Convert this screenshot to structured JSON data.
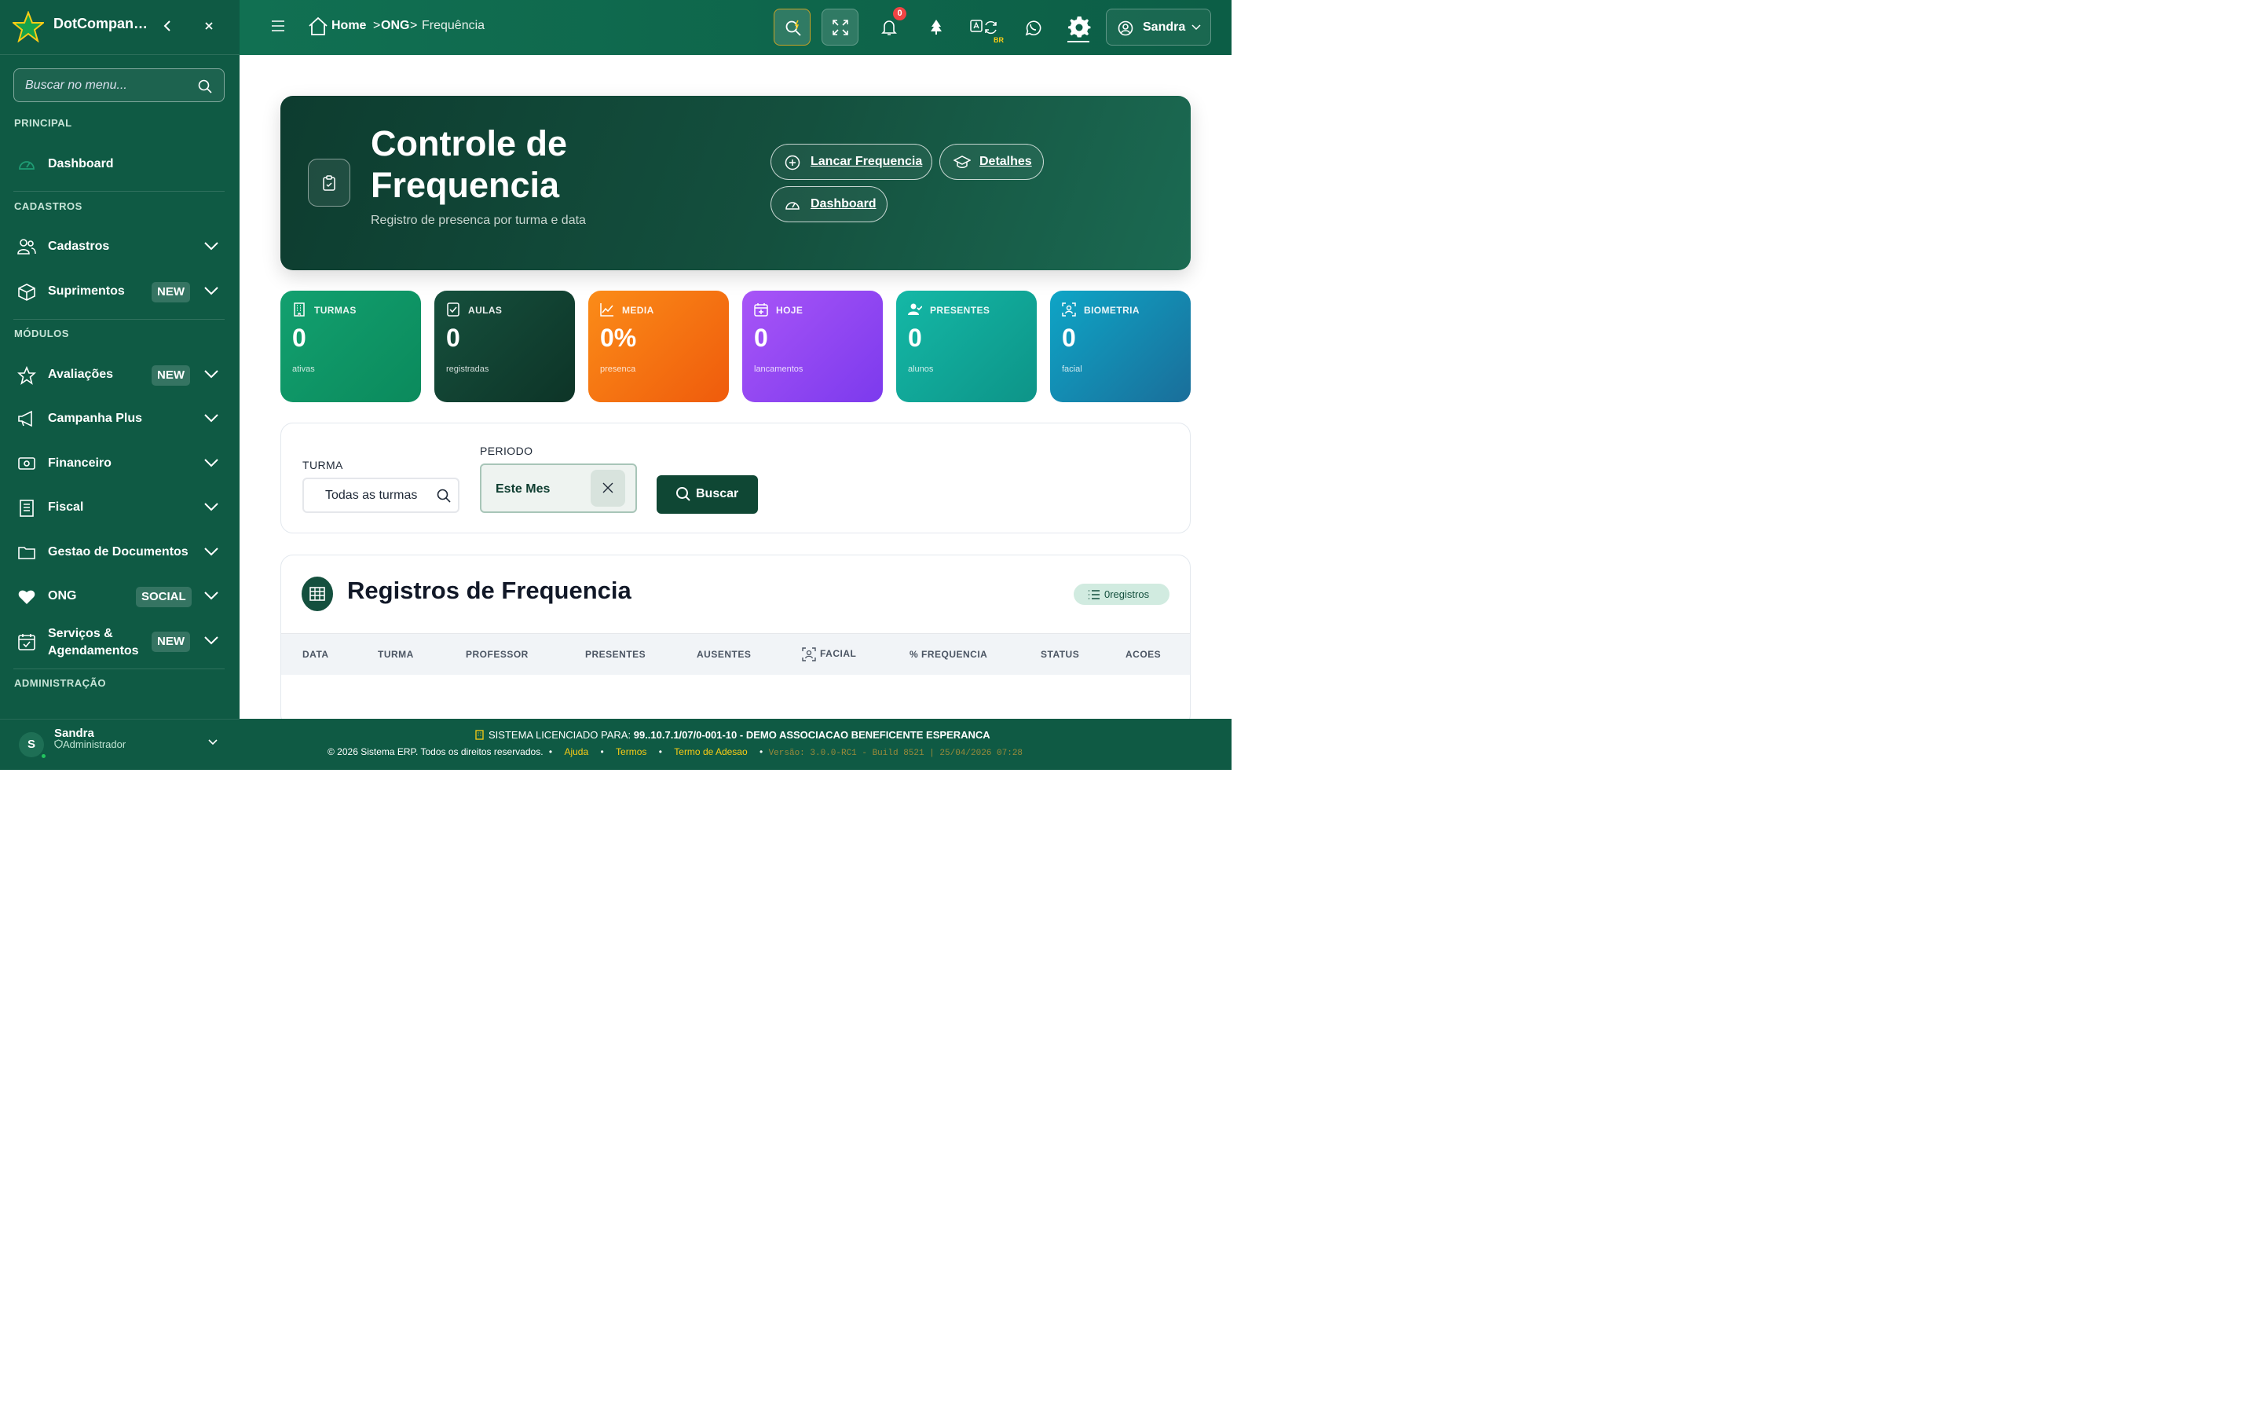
{
  "app": {
    "name": "DotCompanion ERP",
    "collapse_icon": "chevron-left-icon",
    "close_icon": "close-icon"
  },
  "colors": {
    "sidebar": "#0f5a44",
    "topbar": "#117052",
    "hero": "#0d3c2f",
    "accent": "#facc15",
    "badge_red": "#ef4444"
  },
  "sidebar": {
    "search_placeholder": "Buscar no menu...",
    "sections": {
      "principal": "PRINCIPAL",
      "cadastros": "CADASTROS",
      "modulos": "MÓDULOS",
      "administracao": "ADMINISTRAÇÃO"
    },
    "items": {
      "dashboard": {
        "label": "Dashboard",
        "icon": "gauge-icon"
      },
      "cadastros": {
        "label": "Cadastros",
        "icon": "users-icon"
      },
      "suprimentos": {
        "label": "Suprimentos",
        "badge": "NEW",
        "icon": "box-icon"
      },
      "avaliacoes": {
        "label": "Avaliações",
        "badge": "NEW",
        "icon": "star-icon"
      },
      "campanha": {
        "label": "Campanha Plus",
        "icon": "megaphone-icon"
      },
      "financeiro": {
        "label": "Financeiro",
        "icon": "money-icon"
      },
      "fiscal": {
        "label": "Fiscal",
        "icon": "receipt-icon"
      },
      "documentos": {
        "label": "Gestao de Documentos",
        "icon": "folder-icon"
      },
      "ong": {
        "label": "ONG",
        "badge": "SOCIAL",
        "icon": "heart-icon"
      },
      "servicos": {
        "label1": "Serviços &",
        "label2": "Agendamentos",
        "badge": "NEW",
        "icon": "calendar-check-icon"
      }
    },
    "user": {
      "initial": "S",
      "name": "Sandra",
      "role": "Administrador"
    }
  },
  "topbar": {
    "breadcrumb": {
      "home": "Home",
      "sep": ">",
      "ong": "ONG",
      "current": "Frequência"
    },
    "notifications_count": "0",
    "lang_tag": "BR",
    "user_name": "Sandra"
  },
  "hero": {
    "title": "Controle de Frequencia",
    "subtitle": "Registro de presenca por turma e data",
    "buttons": {
      "lancar": "Lancar Frequencia",
      "detalhes": "Detalhes",
      "dashboard": "Dashboard"
    }
  },
  "stats": [
    {
      "label": "TURMAS",
      "value": "0",
      "sub": "ativas",
      "color": "#12a06f",
      "icon": "building-icon"
    },
    {
      "label": "AULAS",
      "value": "0",
      "sub": "registradas",
      "color": "#123c2f",
      "icon": "checklist-icon"
    },
    {
      "label": "MEDIA",
      "value": "0%",
      "sub": "presenca",
      "color": "#f97316",
      "icon": "trend-icon"
    },
    {
      "label": "HOJE",
      "value": "0",
      "sub": "lancamentos",
      "color": "#9333ea",
      "icon": "calendar-plus-icon"
    },
    {
      "label": "PRESENTES",
      "value": "0",
      "sub": "alunos",
      "color": "#14b8a6",
      "icon": "user-check-icon"
    },
    {
      "label": "BIOMETRIA",
      "value": "0",
      "sub": "facial",
      "color": "#0891b2",
      "icon": "face-scan-icon"
    }
  ],
  "filters": {
    "turma_label": "TURMA",
    "turma_value": "Todas as turmas",
    "periodo_label": "PERIODO",
    "periodo_value": "Este Mes",
    "buscar": "Buscar"
  },
  "records": {
    "title": "Registros de Frequencia",
    "count_label": "0registros",
    "columns": [
      "DATA",
      "TURMA",
      "PROFESSOR",
      "PRESENTES",
      "AUSENTES",
      "FACIAL",
      "% FREQUENCIA",
      "STATUS",
      "ACOES"
    ],
    "rows": []
  },
  "footer": {
    "license_prefix": "SISTEMA LICENCIADO PARA:",
    "license_holder": "99..10.7.1/07/0-001-10 - DEMO ASSOCIACAO BENEFICENTE ESPERANCA",
    "copyright": "© 2026 Sistema ERP. Todos os direitos reservados.",
    "links": {
      "ajuda": "Ajuda",
      "termos": "Termos",
      "adesao": "Termo de Adesao"
    },
    "version": "Versão: 3.0.0-RC1 - Build 8521 | 25/04/2026 07:28"
  }
}
